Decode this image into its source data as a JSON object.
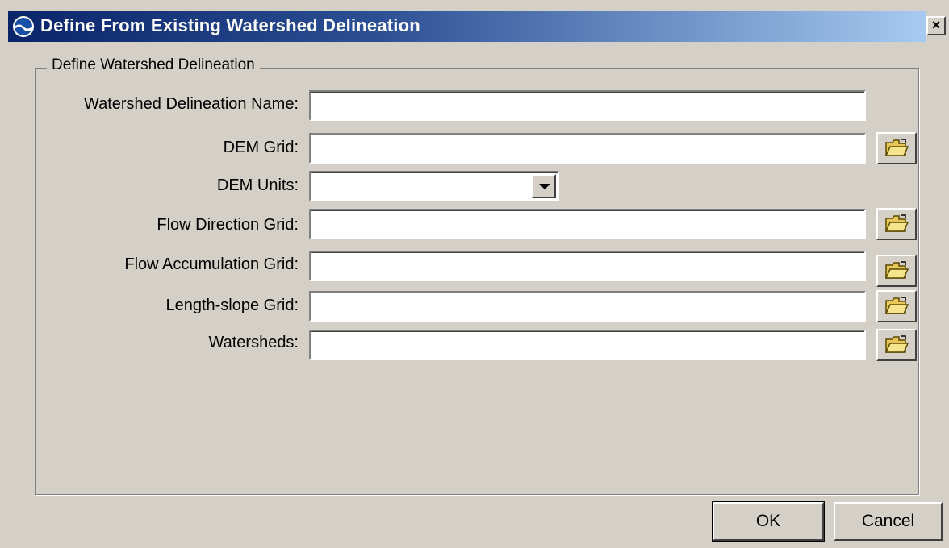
{
  "window": {
    "title": "Define From Existing Watershed Delineation",
    "close_label": "×",
    "icon": "noaa-logo-icon"
  },
  "group": {
    "legend": "Define Watershed Delineation"
  },
  "fields": {
    "name": {
      "label": "Watershed Delineation Name:",
      "value": ""
    },
    "dem_grid": {
      "label": "DEM Grid:",
      "value": ""
    },
    "dem_units": {
      "label": "DEM Units:",
      "value": ""
    },
    "flow_direction": {
      "label": "Flow Direction Grid:",
      "value": ""
    },
    "flow_accumulation": {
      "label": "Flow Accumulation Grid:",
      "value": ""
    },
    "length_slope": {
      "label": "Length-slope Grid:",
      "value": ""
    },
    "watersheds": {
      "label": "Watersheds:",
      "value": ""
    }
  },
  "buttons": {
    "ok": "OK",
    "cancel": "Cancel",
    "browse_icon": "open-folder-icon"
  }
}
